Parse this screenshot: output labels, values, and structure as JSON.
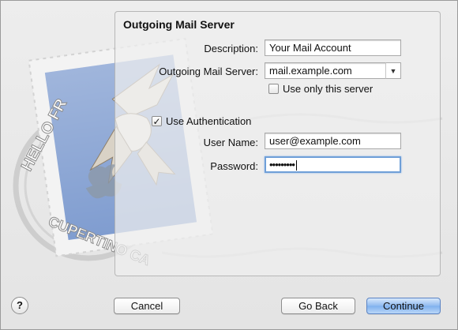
{
  "panel": {
    "title": "Outgoing Mail Server"
  },
  "form": {
    "description_label": "Description:",
    "description_value": "Your Mail Account",
    "server_label": "Outgoing Mail Server:",
    "server_value": "mail.example.com",
    "only_server_label": "Use only this server",
    "only_server_checked": false,
    "use_auth_label": "Use Authentication",
    "use_auth_checked": true,
    "username_label": "User Name:",
    "username_value": "user@example.com",
    "password_label": "Password:",
    "password_value": "•••••••••"
  },
  "stamp": {
    "text_top": "HELLO FR",
    "text_bottom": "CUPERTINO CA"
  },
  "buttons": {
    "help": "?",
    "cancel": "Cancel",
    "go_back": "Go Back",
    "continue": "Continue"
  },
  "icons": {
    "combo_arrow": "chevron-down-icon",
    "checkmark": "check-icon"
  },
  "colors": {
    "focus_ring": "#6f9fd8",
    "default_button": "#8fbaf0",
    "stamp_blue": "#6b8dc9"
  }
}
